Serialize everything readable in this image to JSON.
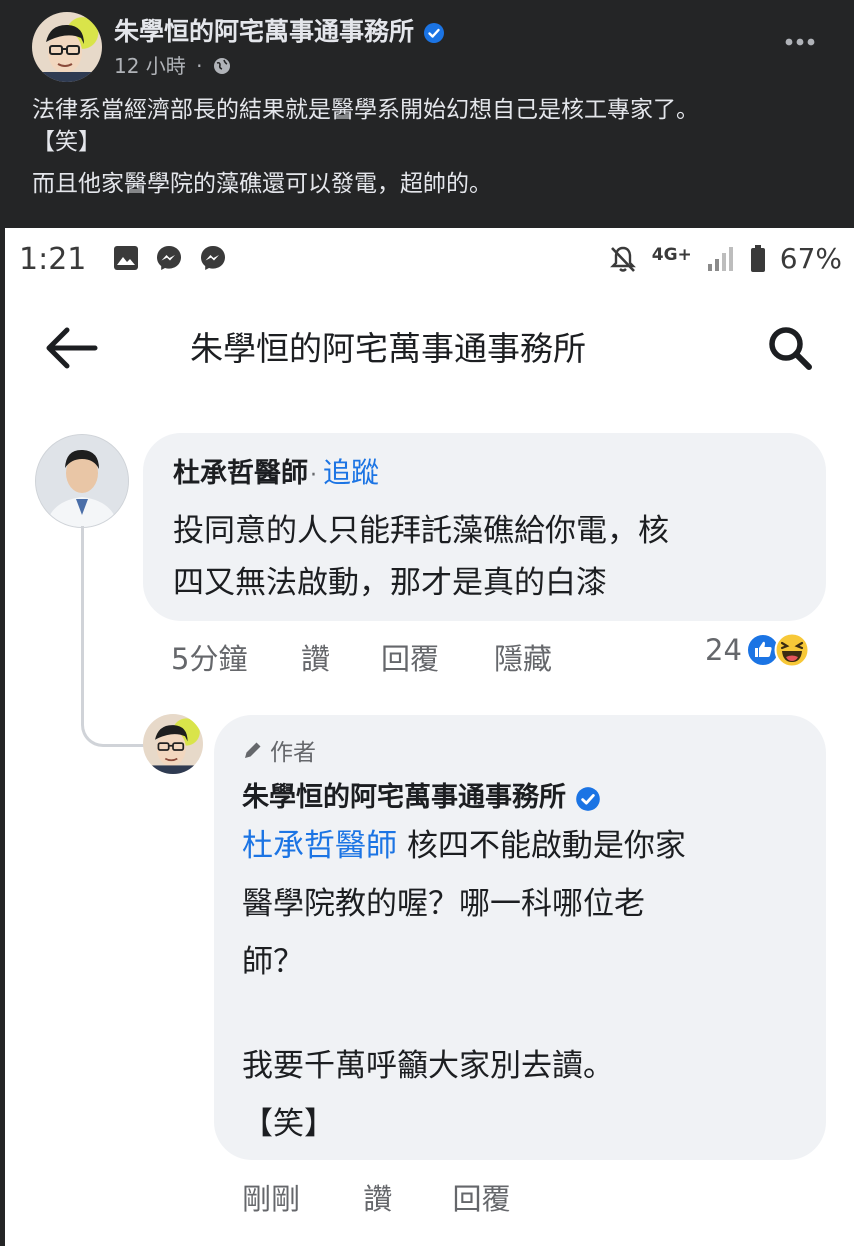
{
  "post": {
    "page_name": "朱學恒的阿宅萬事通事務所",
    "time": "12 小時",
    "dot": "·",
    "text_line1": "法律系當經濟部長的結果就是醫學系開始幻想自己是核工專家了。",
    "text_line2": "【笑】",
    "text_para2": "而且他家醫學院的藻礁還可以發電，超帥的。",
    "icons": [
      "verified-badge-icon",
      "globe-icon",
      "more-icon"
    ],
    "colors": {
      "background": "#242526",
      "text": "#e4e6eb",
      "verified": "#1b74e4"
    }
  },
  "screenshot": {
    "status_bar": {
      "time": "1:21",
      "network": "4G+",
      "battery": "67%",
      "icons": [
        "gallery-icon",
        "messenger-icon",
        "messenger-icon",
        "mute-bell-icon",
        "signal-icon",
        "battery-icon"
      ]
    },
    "app_bar": {
      "title": "朱學恒的阿宅萬事通事務所",
      "icons": [
        "back-arrow-icon",
        "search-icon"
      ]
    },
    "comment1": {
      "author": "杜承哲醫師",
      "separator": "·",
      "follow": "追蹤",
      "text_line1": "投同意的人只能拜託藻礁給你電，核",
      "text_line2": "四又無法啟動，那才是真的白漆",
      "time": "5分鐘",
      "like": "讚",
      "reply": "回覆",
      "hide": "隱藏",
      "reaction_count": "24",
      "reactions": [
        "like-reaction-icon",
        "haha-reaction-icon"
      ]
    },
    "comment2": {
      "author_badge": "作者",
      "author": "朱學恒的阿宅萬事通事務所",
      "mention": "杜承哲醫師",
      "text_line1_rest": " 核四不能啟動是你家",
      "text_line2": "醫學院教的喔？哪一科哪位老",
      "text_line3": "師？",
      "text_line4": "我要千萬呼籲大家別去讀。",
      "text_line5": "【笑】",
      "time": "剛剛",
      "like": "讚",
      "reply": "回覆"
    }
  }
}
